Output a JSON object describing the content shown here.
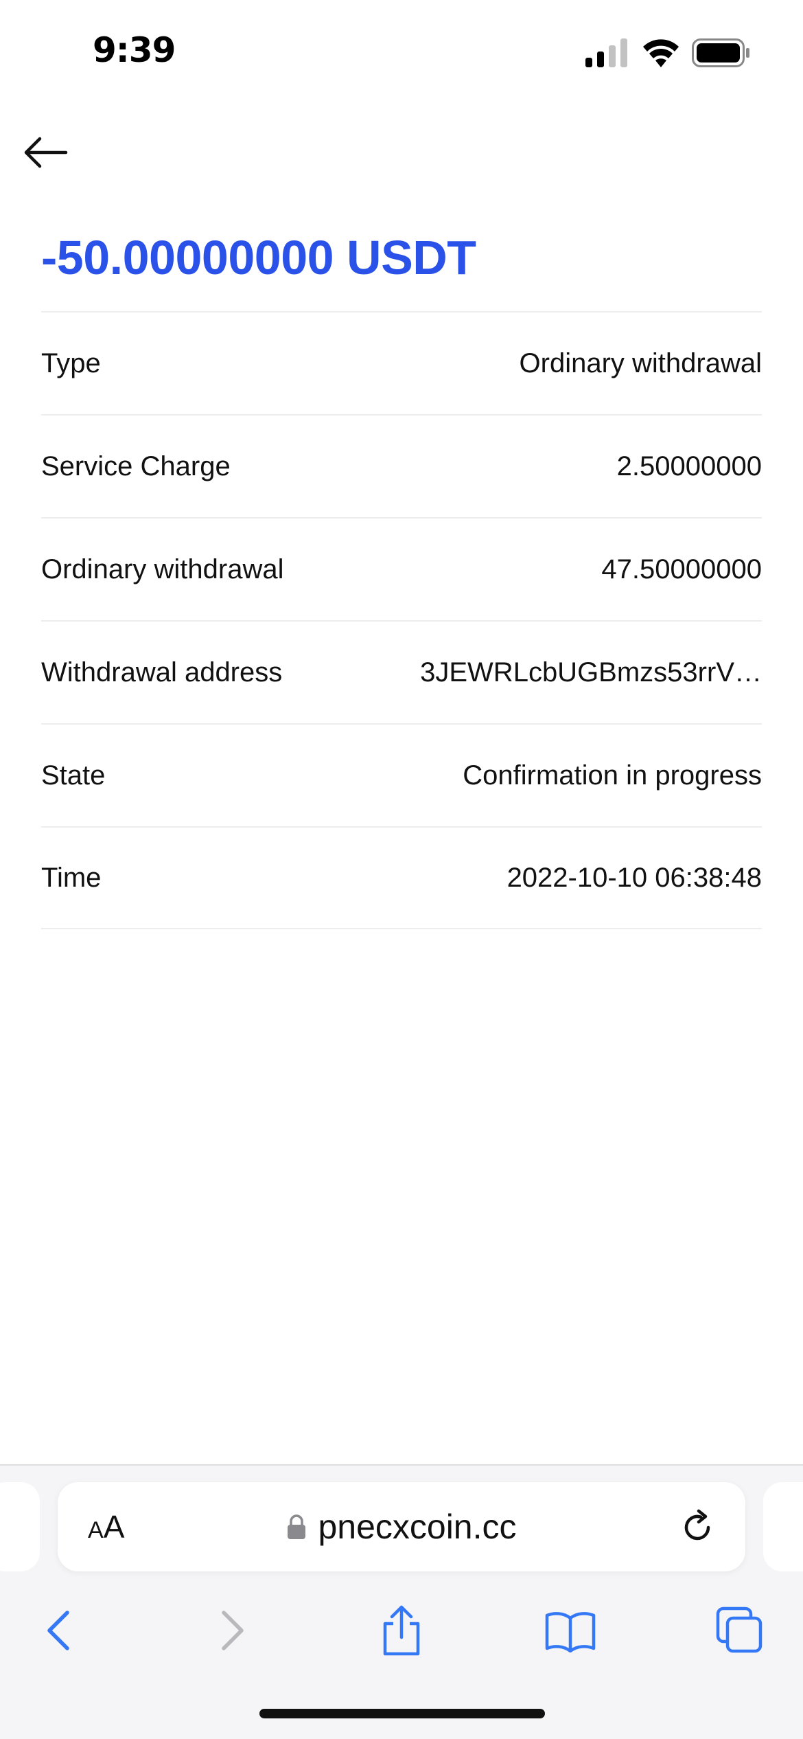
{
  "status_bar": {
    "time": "9:39",
    "icons": [
      "signal-icon",
      "wifi-icon",
      "battery-icon"
    ]
  },
  "nav": {
    "back_icon": "arrow-left-icon"
  },
  "amount": "-50.00000000 USDT",
  "colors": {
    "accent": "#2a52e8",
    "divider": "#ededed",
    "browser_blue": "#3478f6"
  },
  "details": [
    {
      "label": "Type",
      "value": "Ordinary withdrawal"
    },
    {
      "label": "Service Charge",
      "value": "2.50000000"
    },
    {
      "label": "Ordinary withdrawal",
      "value": "47.50000000"
    },
    {
      "label": "Withdrawal address",
      "value": "3JEWRLcbUGBmzs53rrV…"
    },
    {
      "label": "State",
      "value": "Confirmation in progress"
    },
    {
      "label": "Time",
      "value": "2022-10-10 06:38:48"
    }
  ],
  "browser": {
    "text_size_small": "A",
    "text_size_large": "A",
    "url": "pnecxcoin.cc",
    "toolbar_icons": [
      "back-icon",
      "forward-icon",
      "share-icon",
      "bookmarks-icon",
      "tabs-icon"
    ]
  }
}
